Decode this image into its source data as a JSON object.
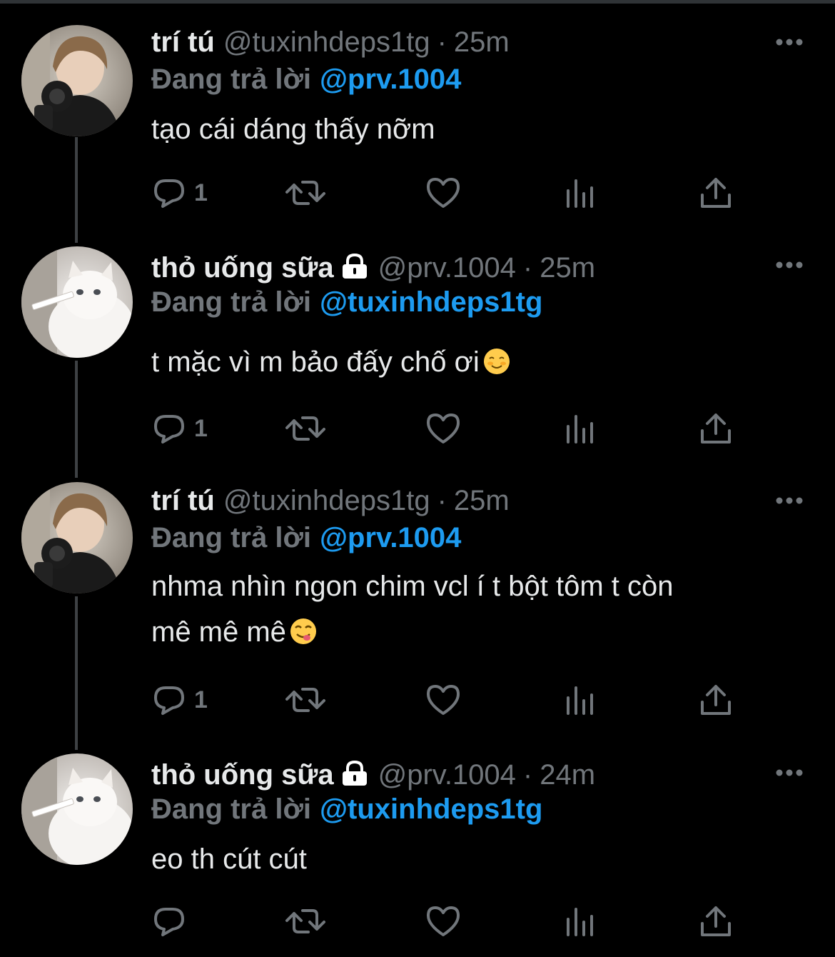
{
  "tweets": [
    {
      "name": "trí tú",
      "handle": "@tuxinhdeps1tg",
      "separator": "·",
      "time": "25m",
      "reply_prefix": "Đang trả lời",
      "reply_to": "@prv.1004",
      "text": "tạo cái dáng thấy nỡm",
      "reply_count": "1",
      "avatar": "boy-photo"
    },
    {
      "name": "thỏ uống sữa",
      "handle": "@prv.1004",
      "separator": "·",
      "time": "25m",
      "reply_prefix": "Đang trả lời",
      "reply_to": "@tuxinhdeps1tg",
      "text": "t mặc vì m bảo đấy chố ơi",
      "emoji": "relaxed-smile-emoji",
      "reply_count": "1",
      "locked": true,
      "avatar": "white-cat-photo"
    },
    {
      "name": "trí tú",
      "handle": "@tuxinhdeps1tg",
      "separator": "·",
      "time": "25m",
      "reply_prefix": "Đang trả lời",
      "reply_to": "@prv.1004",
      "text_line1": "nhma nhìn ngon chim vcl í t bột tôm t còn",
      "text_line2": "mê mê mê",
      "emoji": "yum-face-emoji",
      "reply_count": "1",
      "avatar": "boy-photo"
    },
    {
      "name": "thỏ uống sữa",
      "handle": "@prv.1004",
      "separator": "·",
      "time": "24m",
      "reply_prefix": "Đang trả lời",
      "reply_to": "@tuxinhdeps1tg",
      "text": "eo th cút cút",
      "reply_count": "",
      "locked": true,
      "avatar": "white-cat-photo"
    }
  ],
  "icons": {
    "reply": "reply-icon",
    "retweet": "retweet-icon",
    "like": "like-icon",
    "views": "views-icon",
    "share": "share-icon",
    "more": "more-icon",
    "lock": "lock-icon"
  },
  "colors": {
    "background": "#000000",
    "text": "#e7e9ea",
    "muted": "#71767b",
    "link": "#1d9bf0",
    "thread_line": "#3e4144"
  }
}
